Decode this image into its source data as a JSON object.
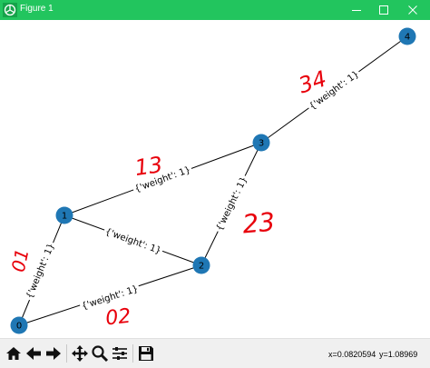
{
  "window": {
    "title": "Figure 1"
  },
  "graph": {
    "nodes": [
      {
        "id": "n0",
        "label": "0"
      },
      {
        "id": "n1",
        "label": "1"
      },
      {
        "id": "n2",
        "label": "2"
      },
      {
        "id": "n3",
        "label": "3"
      },
      {
        "id": "n4",
        "label": "4"
      }
    ],
    "edges": [
      {
        "from": "0",
        "to": "1",
        "label": "{'weight': 1}"
      },
      {
        "from": "0",
        "to": "2",
        "label": "{'weight': 1}"
      },
      {
        "from": "1",
        "to": "2",
        "label": "{'weight': 1}"
      },
      {
        "from": "1",
        "to": "3",
        "label": "{'weight': 1}"
      },
      {
        "from": "2",
        "to": "3",
        "label": "{'weight': 1}"
      },
      {
        "from": "3",
        "to": "4",
        "label": "{'weight': 1}"
      }
    ],
    "handwritten_annotations": [
      "01",
      "02",
      "13",
      "23",
      "34"
    ],
    "colors": {
      "node": "#1f77b4",
      "edge": "#000000",
      "annotation": "#e8000b"
    }
  },
  "toolbar": {
    "tools": [
      {
        "name": "home",
        "icon": "home-icon"
      },
      {
        "name": "back",
        "icon": "arrow-left-icon"
      },
      {
        "name": "forward",
        "icon": "arrow-right-icon"
      },
      {
        "name": "pan",
        "icon": "move-icon"
      },
      {
        "name": "zoom",
        "icon": "magnifier-icon"
      },
      {
        "name": "configure",
        "icon": "sliders-icon"
      },
      {
        "name": "save",
        "icon": "floppy-disk-icon"
      }
    ],
    "coords": {
      "x": "x=0.0820594",
      "y": "y=1.08969"
    }
  }
}
